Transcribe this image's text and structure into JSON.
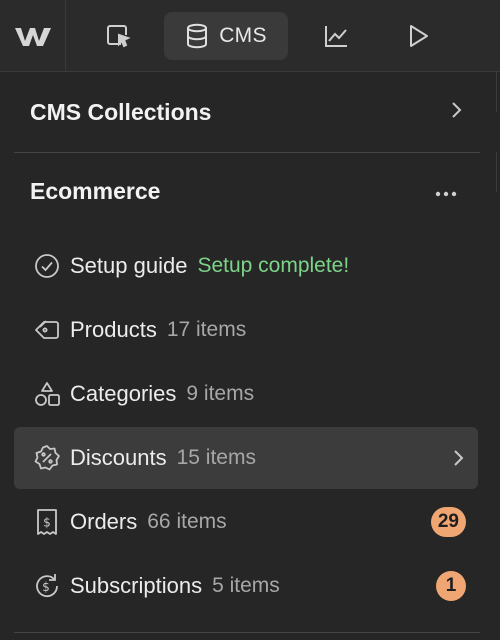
{
  "toolbar": {
    "logo_icon": "webflow-logo-icon",
    "tools": [
      {
        "icon": "select-cursor-icon"
      },
      {
        "icon": "database-icon",
        "label": "CMS",
        "active": true
      },
      {
        "icon": "analytics-chart-icon"
      },
      {
        "icon": "play-preview-icon"
      }
    ]
  },
  "panel": {
    "collections_label": "CMS Collections",
    "section_title": "Ecommerce",
    "items": [
      {
        "icon": "check-circle-icon",
        "name": "Setup guide",
        "meta": "Setup complete!"
      },
      {
        "icon": "tag-icon",
        "name": "Products",
        "meta": "17 items"
      },
      {
        "icon": "shapes-icon",
        "name": "Categories",
        "meta": "9 items"
      },
      {
        "icon": "discount-badge-icon",
        "name": "Discounts",
        "meta": "15 items",
        "selected": true
      },
      {
        "icon": "receipt-icon",
        "name": "Orders",
        "meta": "66 items",
        "badge": "29"
      },
      {
        "icon": "subscription-icon",
        "name": "Subscriptions",
        "meta": "5 items",
        "badge": "1"
      }
    ]
  },
  "colors": {
    "background": "#262626",
    "selected_row": "#3c3c3c",
    "success_text": "#7cd488",
    "badge": "#f0a672"
  }
}
